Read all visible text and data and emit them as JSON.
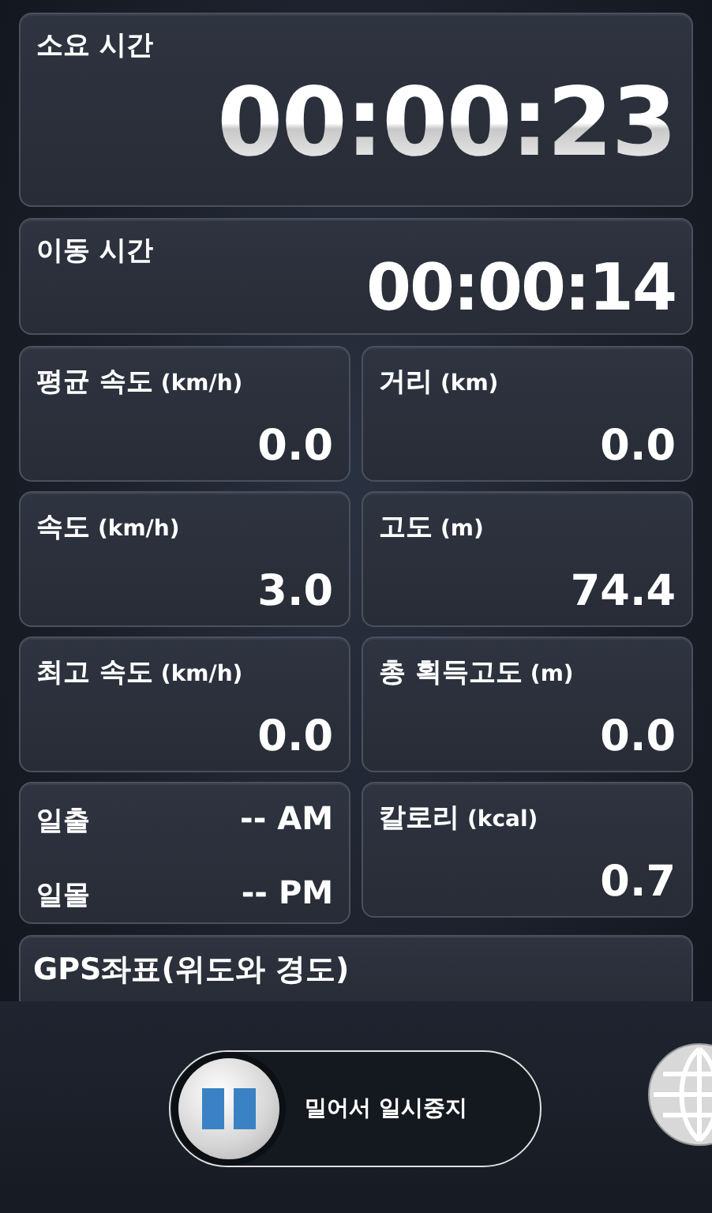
{
  "timers": [
    {
      "label": "소요 시간",
      "value": "00:00:23",
      "kind": "large"
    },
    {
      "label": "이동 시간",
      "value": "00:00:14",
      "kind": "medium"
    }
  ],
  "stats": [
    {
      "kind": "stat",
      "label": "평균 속도",
      "unit": "(km/h)",
      "value": "0.0"
    },
    {
      "kind": "stat",
      "label": "거리",
      "unit": "(km)",
      "value": "0.0"
    },
    {
      "kind": "stat",
      "label": "속도",
      "unit": "(km/h)",
      "value": "3.0"
    },
    {
      "kind": "stat",
      "label": "고도",
      "unit": "(m)",
      "value": "74.4"
    },
    {
      "kind": "stat",
      "label": "최고 속도",
      "unit": "(km/h)",
      "value": "0.0"
    },
    {
      "kind": "stat",
      "label": "총 획득고도",
      "unit": "(m)",
      "value": "0.0"
    },
    {
      "kind": "sun",
      "rows": [
        {
          "label": "일출",
          "value": "-- AM"
        },
        {
          "label": "일몰",
          "value": "-- PM"
        }
      ]
    },
    {
      "kind": "stat",
      "label": "칼로리",
      "unit": "(kcal)",
      "value": "0.7"
    }
  ],
  "gps": {
    "label": "GPS좌표(위도와 경도)"
  },
  "slider": {
    "label": "밀어서 일시중지",
    "level": 0
  }
}
